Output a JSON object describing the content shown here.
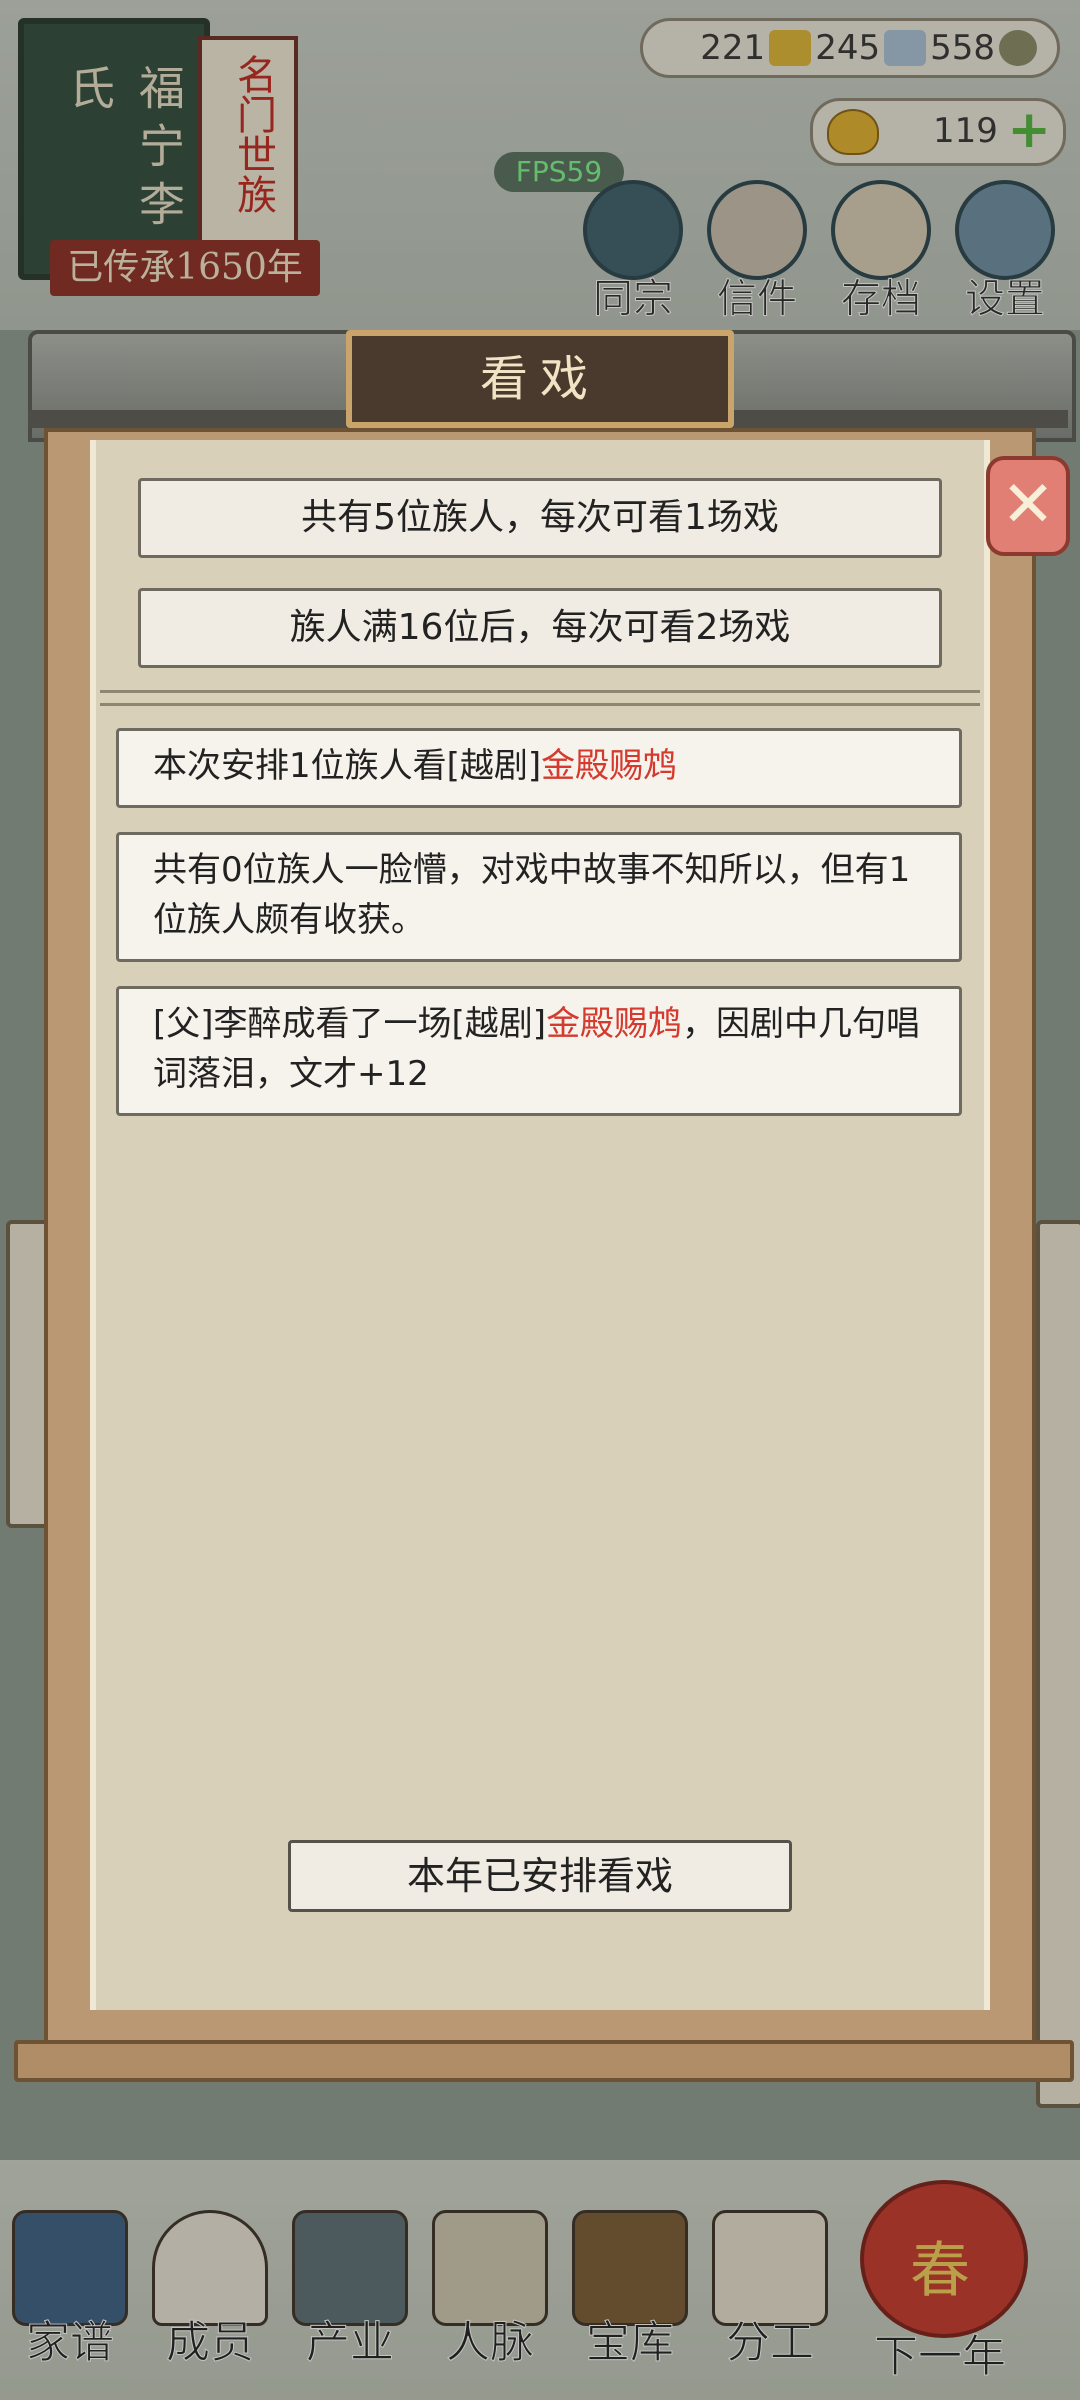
{
  "family": {
    "name": "福宁李氏",
    "clan_badge": "名门世族",
    "inherit_text": "已传承1650年"
  },
  "resources": {
    "items": [
      {
        "icon": "gold-bars-icon",
        "value": "221"
      },
      {
        "icon": "silver-bars-icon",
        "value": "245"
      },
      {
        "icon": "coin-icon",
        "value": "558"
      }
    ],
    "ingot_value": "119",
    "add_label": "+"
  },
  "fps": "FPS59",
  "top_menu": [
    {
      "id": "clan",
      "label": "同宗",
      "icon": "books-icon"
    },
    {
      "id": "letters",
      "label": "信件",
      "icon": "letter-icon"
    },
    {
      "id": "save",
      "label": "存档",
      "icon": "scroll-icon"
    },
    {
      "id": "settings",
      "label": "设置",
      "icon": "gear-icon"
    }
  ],
  "modal": {
    "title": "看戏",
    "close_icon": "close-icon",
    "info_lines": [
      "共有5位族人，每次可看1场戏",
      "族人满16位后，每次可看2场戏"
    ],
    "messages": [
      {
        "before": "本次安排1位族人看[越剧]",
        "highlight": "金殿赐鸩",
        "after": ""
      },
      {
        "before": "共有0位族人一脸懵，对戏中故事不知所以，但有1位族人颇有收获。",
        "highlight": "",
        "after": ""
      },
      {
        "before": "[父]李醉成看了一场[越剧]",
        "highlight": "金殿赐鸩",
        "after": "，因剧中几句唱词落泪，文才+12"
      }
    ],
    "done_button": "本年已安排看戏"
  },
  "bottom_nav": [
    {
      "id": "genealogy",
      "label": "家谱",
      "icon": "book-icon"
    },
    {
      "id": "members",
      "label": "成员",
      "icon": "person-icon"
    },
    {
      "id": "industry",
      "label": "产业",
      "icon": "building-icon"
    },
    {
      "id": "network",
      "label": "人脉",
      "icon": "network-icon"
    },
    {
      "id": "treasury",
      "label": "宝库",
      "icon": "chest-icon"
    },
    {
      "id": "division",
      "label": "分工",
      "icon": "scroll-icon"
    }
  ],
  "next_year": {
    "label": "下一年",
    "lantern_text": "春"
  },
  "colors": {
    "highlight": "#d43a2e",
    "fps": "#7ef58a"
  }
}
